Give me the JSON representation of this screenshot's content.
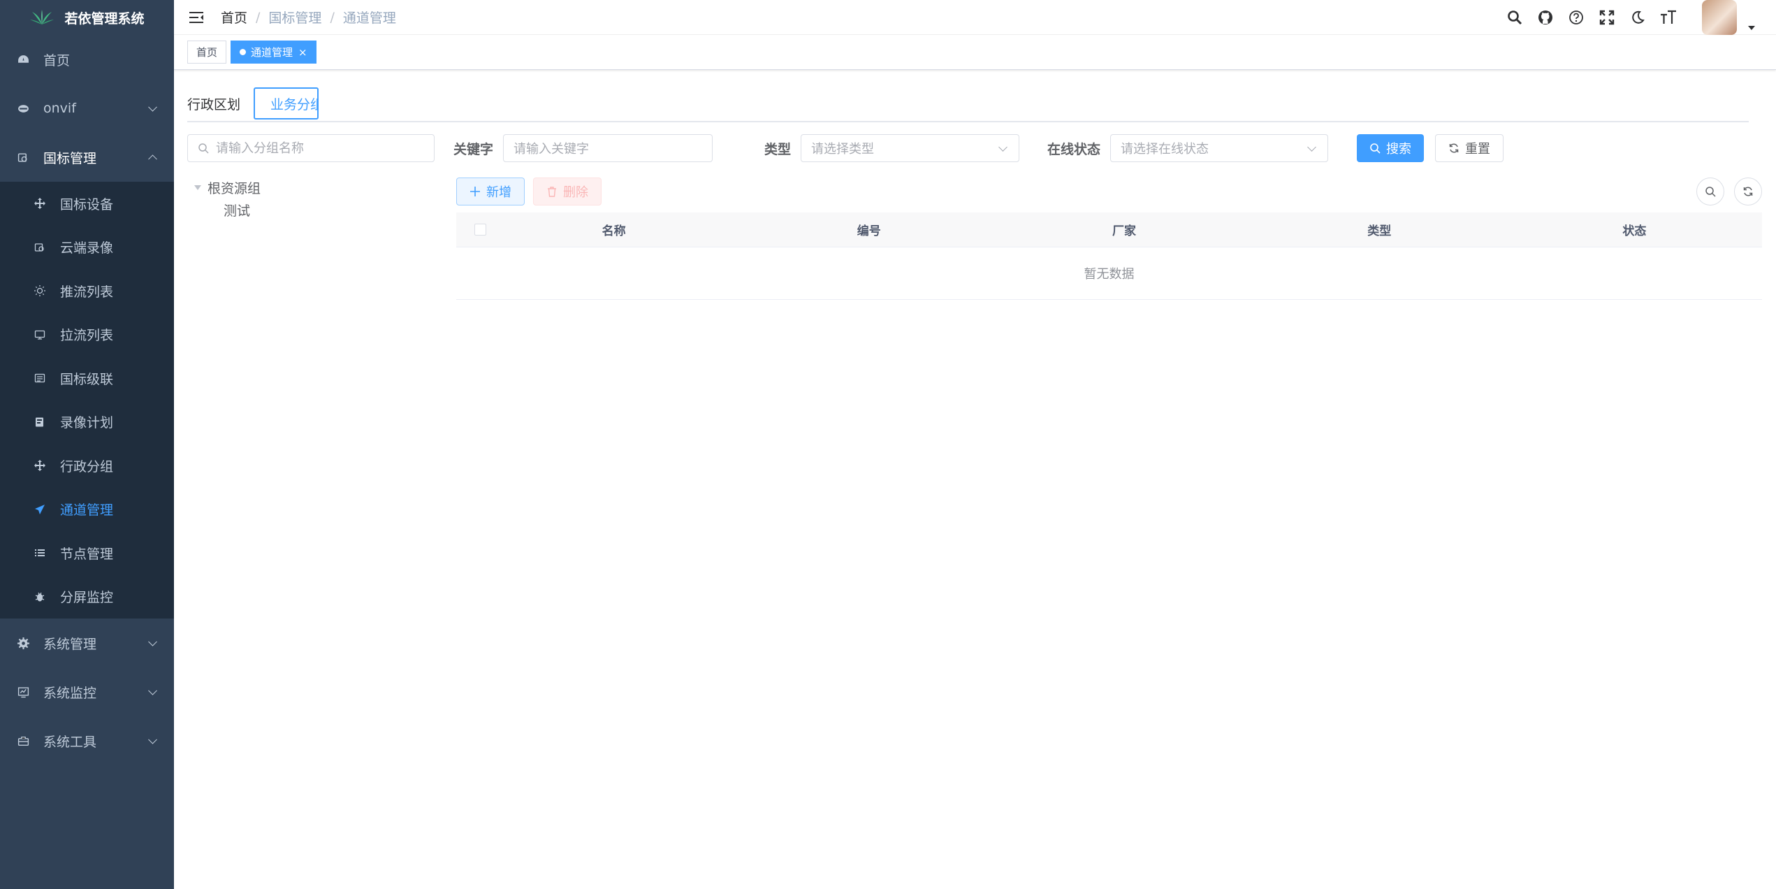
{
  "app": {
    "title": "若依管理系统"
  },
  "sidebar": {
    "items": [
      {
        "label": "首页"
      },
      {
        "label": "onvif"
      },
      {
        "label": "国标管理"
      },
      {
        "label": "系统管理"
      },
      {
        "label": "系统监控"
      },
      {
        "label": "系统工具"
      }
    ],
    "subitems": [
      {
        "label": "国标设备"
      },
      {
        "label": "云端录像"
      },
      {
        "label": "推流列表"
      },
      {
        "label": "拉流列表"
      },
      {
        "label": "国标级联"
      },
      {
        "label": "录像计划"
      },
      {
        "label": "行政分组"
      },
      {
        "label": "通道管理"
      },
      {
        "label": "节点管理"
      },
      {
        "label": "分屏监控"
      }
    ]
  },
  "breadcrumb": [
    "首页",
    "国标管理",
    "通道管理"
  ],
  "tags": [
    {
      "label": "首页"
    },
    {
      "label": "通道管理"
    }
  ],
  "tabs": [
    "行政区划",
    "业务分组"
  ],
  "tree": {
    "search_placeholder": "请输入分组名称",
    "root": "根资源组",
    "children": [
      "测试"
    ]
  },
  "filters": {
    "keyword_label": "关键字",
    "keyword_placeholder": "请输入关键字",
    "type_label": "类型",
    "type_placeholder": "请选择类型",
    "status_label": "在线状态",
    "status_placeholder": "请选择在线状态",
    "search_button": "搜索",
    "reset_button": "重置"
  },
  "toolbar": {
    "add_label": "新增",
    "delete_label": "删除"
  },
  "table": {
    "columns": [
      "名称",
      "编号",
      "厂家",
      "类型",
      "状态"
    ],
    "empty_text": "暂无数据"
  },
  "colors": {
    "accent": "#409eff",
    "sidebar": "#304156",
    "submenu": "#1f2d3d"
  }
}
